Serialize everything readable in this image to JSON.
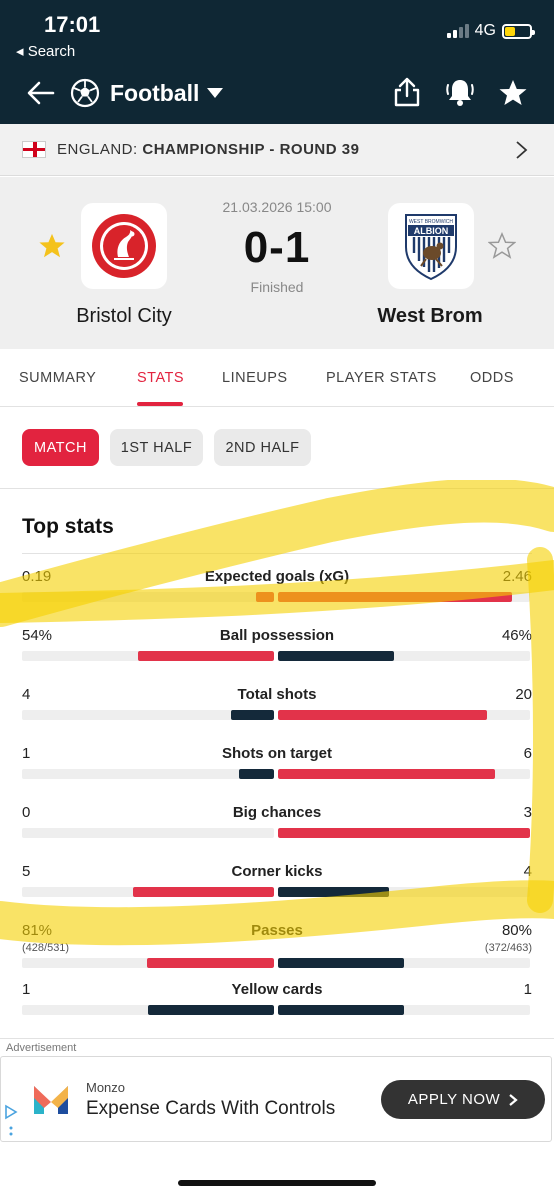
{
  "status_bar": {
    "time": "17:01",
    "back_label": "◂ Search",
    "network": "4G"
  },
  "nav": {
    "title": "Football",
    "icons": [
      "back-arrow-icon",
      "football-icon",
      "share-icon",
      "bell-icon",
      "star-icon"
    ]
  },
  "league": {
    "country": "ENGLAND:",
    "competition": "CHAMPIONSHIP - ROUND 39"
  },
  "match": {
    "datetime": "21.03.2026 15:00",
    "score": "0-1",
    "status": "Finished",
    "home": {
      "name": "Bristol City"
    },
    "away": {
      "name": "West Brom",
      "crest_text_top": "WEST BROMWICH",
      "crest_text_main": "ALBION"
    }
  },
  "tabs": [
    "SUMMARY",
    "STATS",
    "LINEUPS",
    "PLAYER STATS",
    "ODDS"
  ],
  "active_tab": "STATS",
  "periods": [
    "MATCH",
    "1ST HALF",
    "2ND HALF"
  ],
  "active_period": "MATCH",
  "section_title": "Top stats",
  "stats": [
    {
      "label": "Expected goals (xG)",
      "home": "0.19",
      "away": "2.46",
      "home_share": 0.07,
      "away_share": 0.93,
      "home_color": "#e2334a",
      "away_color": "#e2334a"
    },
    {
      "label": "Ball possession",
      "home": "54%",
      "away": "46%",
      "home_share": 0.54,
      "away_share": 0.46,
      "home_color": "#e2334a",
      "away_color": "#14293a"
    },
    {
      "label": "Total shots",
      "home": "4",
      "away": "20",
      "home_share": 0.17,
      "away_share": 0.83,
      "home_color": "#14293a",
      "away_color": "#e2334a"
    },
    {
      "label": "Shots on target",
      "home": "1",
      "away": "6",
      "home_share": 0.14,
      "away_share": 0.86,
      "home_color": "#14293a",
      "away_color": "#e2334a"
    },
    {
      "label": "Big chances",
      "home": "0",
      "away": "3",
      "home_share": 0.0,
      "away_share": 1.0,
      "home_color": "#14293a",
      "away_color": "#e2334a"
    },
    {
      "label": "Corner kicks",
      "home": "5",
      "away": "4",
      "home_share": 0.56,
      "away_share": 0.44,
      "home_color": "#e2334a",
      "away_color": "#14293a"
    },
    {
      "label": "Passes",
      "home": "81%",
      "away": "80%",
      "home_sub": "(428/531)",
      "away_sub": "(372/463)",
      "home_share": 0.505,
      "away_share": 0.5,
      "home_color": "#e2334a",
      "away_color": "#14293a"
    },
    {
      "label": "Yellow cards",
      "home": "1",
      "away": "1",
      "home_share": 0.5,
      "away_share": 0.5,
      "home_color": "#14293a",
      "away_color": "#14293a"
    }
  ],
  "ad": {
    "label": "Advertisement",
    "brand": "Monzo",
    "text": "Expense Cards With Controls",
    "cta": "APPLY NOW"
  }
}
